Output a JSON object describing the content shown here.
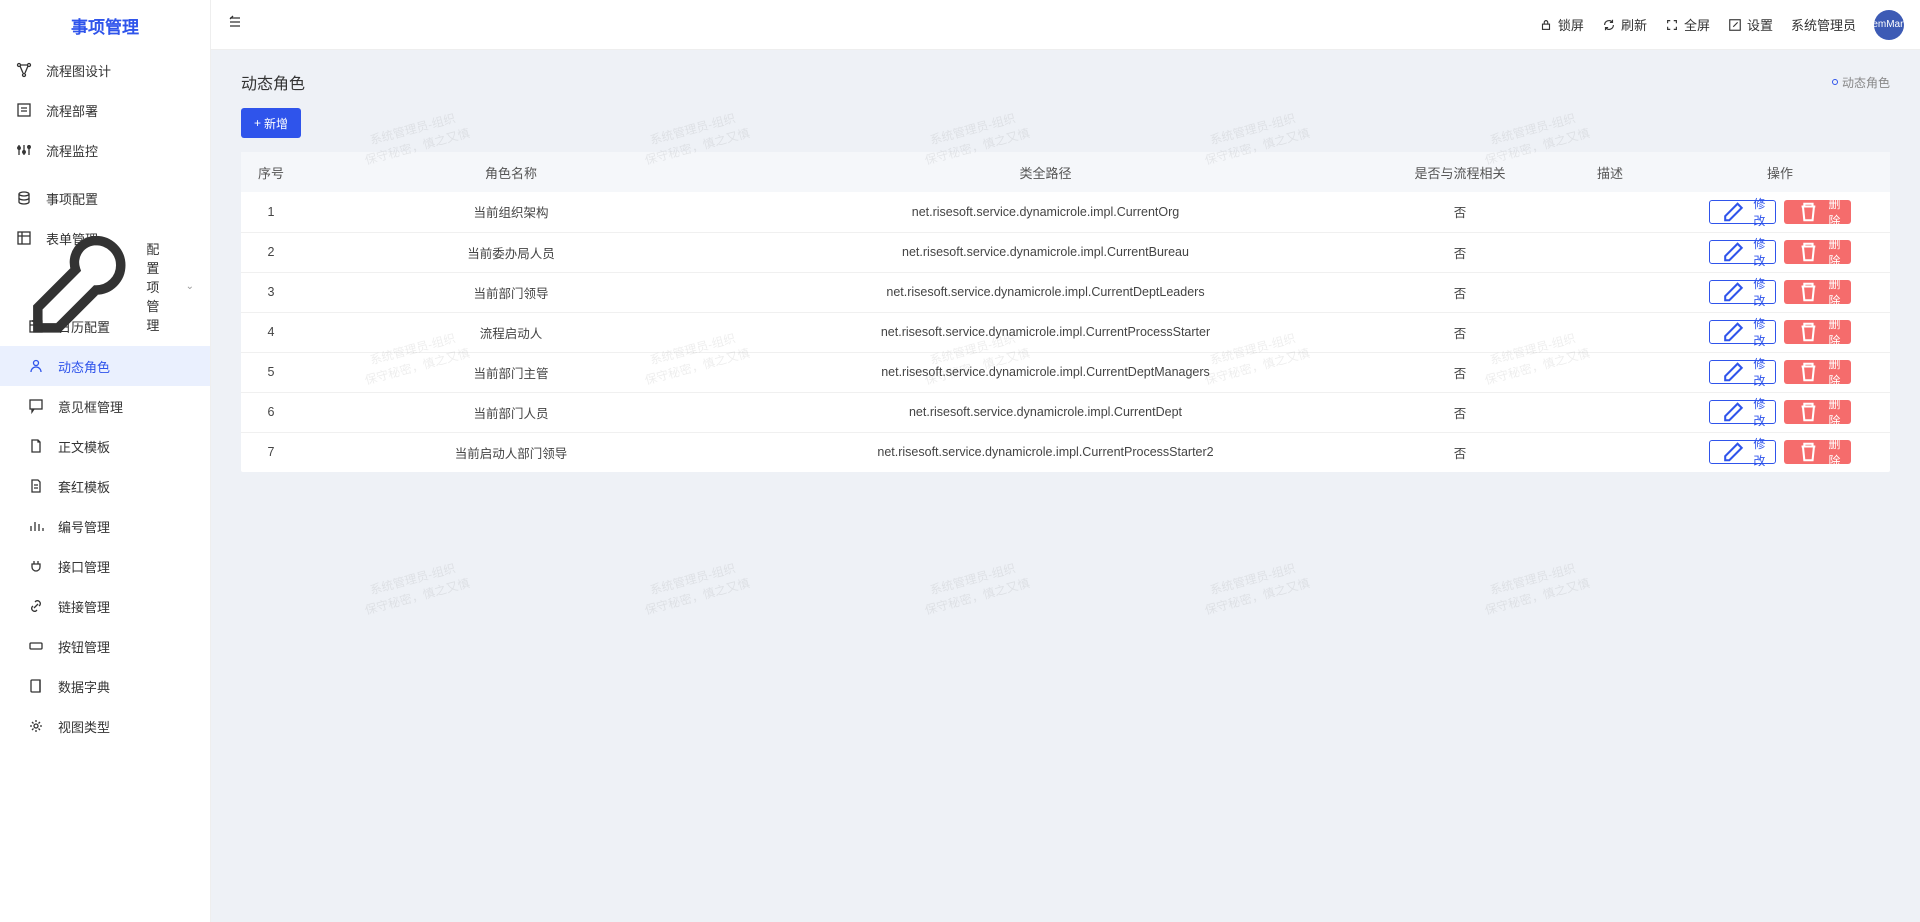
{
  "app": {
    "name": "事项管理"
  },
  "topbar": {
    "lock": "锁屏",
    "refresh": "刷新",
    "fullscreen": "全屏",
    "settings": "设置",
    "user": "系统管理员",
    "avatar": "emMan"
  },
  "sidebar": {
    "items": [
      {
        "label": "流程图设计"
      },
      {
        "label": "流程部署"
      },
      {
        "label": "流程监控"
      },
      {
        "label": "事项配置"
      },
      {
        "label": "表单管理"
      }
    ],
    "group": {
      "label": "配置项管理",
      "children": [
        {
          "label": "日历配置"
        },
        {
          "label": "动态角色"
        },
        {
          "label": "意见框管理"
        },
        {
          "label": "正文模板"
        },
        {
          "label": "套红模板"
        },
        {
          "label": "编号管理"
        },
        {
          "label": "接口管理"
        },
        {
          "label": "链接管理"
        },
        {
          "label": "按钮管理"
        },
        {
          "label": "数据字典"
        },
        {
          "label": "视图类型"
        }
      ]
    }
  },
  "page": {
    "title": "动态角色",
    "breadcrumb": "动态角色",
    "add_label": "新增"
  },
  "table": {
    "headers": {
      "seq": "序号",
      "name": "角色名称",
      "path": "类全路径",
      "related": "是否与流程相关",
      "desc": "描述",
      "op": "操作"
    },
    "edit_label": "修改",
    "delete_label": "删除",
    "rows": [
      {
        "seq": "1",
        "name": "当前组织架构",
        "path": "net.risesoft.service.dynamicrole.impl.CurrentOrg",
        "related": "否",
        "desc": ""
      },
      {
        "seq": "2",
        "name": "当前委办局人员",
        "path": "net.risesoft.service.dynamicrole.impl.CurrentBureau",
        "related": "否",
        "desc": ""
      },
      {
        "seq": "3",
        "name": "当前部门领导",
        "path": "net.risesoft.service.dynamicrole.impl.CurrentDeptLeaders",
        "related": "否",
        "desc": ""
      },
      {
        "seq": "4",
        "name": "流程启动人",
        "path": "net.risesoft.service.dynamicrole.impl.CurrentProcessStarter",
        "related": "否",
        "desc": ""
      },
      {
        "seq": "5",
        "name": "当前部门主管",
        "path": "net.risesoft.service.dynamicrole.impl.CurrentDeptManagers",
        "related": "否",
        "desc": ""
      },
      {
        "seq": "6",
        "name": "当前部门人员",
        "path": "net.risesoft.service.dynamicrole.impl.CurrentDept",
        "related": "否",
        "desc": ""
      },
      {
        "seq": "7",
        "name": "当前启动人部门领导",
        "path": "net.risesoft.service.dynamicrole.impl.CurrentProcessStarter2",
        "related": "否",
        "desc": ""
      }
    ]
  },
  "watermark": {
    "line1": "系统管理员-组织",
    "line2": "保守秘密，慎之又慎"
  }
}
